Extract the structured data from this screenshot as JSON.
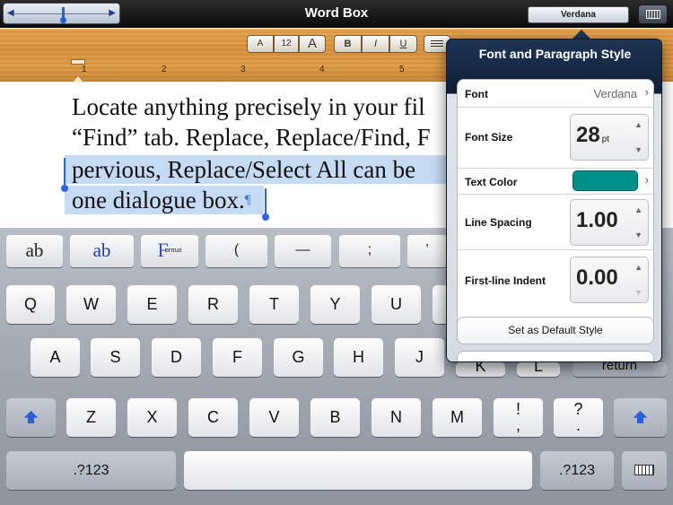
{
  "app": {
    "title": "Word Box"
  },
  "topbar": {
    "font_button": "Verdana"
  },
  "toolbar": {
    "buttons": [
      "A",
      "12",
      "A",
      "B",
      "I",
      "U"
    ],
    "ruler_numbers": [
      "1",
      "2",
      "3",
      "4",
      "5"
    ]
  },
  "document": {
    "lines": [
      "Locate anything precisely in your fil",
      "“Find” tab. Replace, Replace/Find, F",
      "pervious, Replace/Select All can be",
      "one dialogue box."
    ],
    "pilcrow": "¶"
  },
  "popover": {
    "title": "Font and Paragraph Style",
    "font_label": "Font",
    "font_value": "Verdana",
    "size_label": "Font Size",
    "size_value": "28",
    "size_unit": "pt",
    "color_label": "Text Color",
    "color_value": "#00928a",
    "spacing_label": "Line Spacing",
    "spacing_value": "1.00",
    "indent_label": "First-line Indent",
    "indent_value": "0.00",
    "default_button": "Set as Default Style",
    "up_arrow": "▲",
    "down_arrow": "▼",
    "chevron": "›"
  },
  "keyboard": {
    "function_keys": [
      "ab",
      "ab",
      "F",
      "(",
      "—",
      ";",
      "’"
    ],
    "format_caption": "ormat",
    "row1": [
      "Q",
      "W",
      "E",
      "R",
      "T",
      "Y",
      "U"
    ],
    "row2": [
      "A",
      "S",
      "D",
      "F",
      "G",
      "H",
      "J",
      "K",
      "L"
    ],
    "row3": [
      "Z",
      "X",
      "C",
      "V",
      "B",
      "N",
      "M",
      "!\n,",
      "?\n."
    ],
    "return_label": "return",
    "numbers_label": ".?123"
  }
}
